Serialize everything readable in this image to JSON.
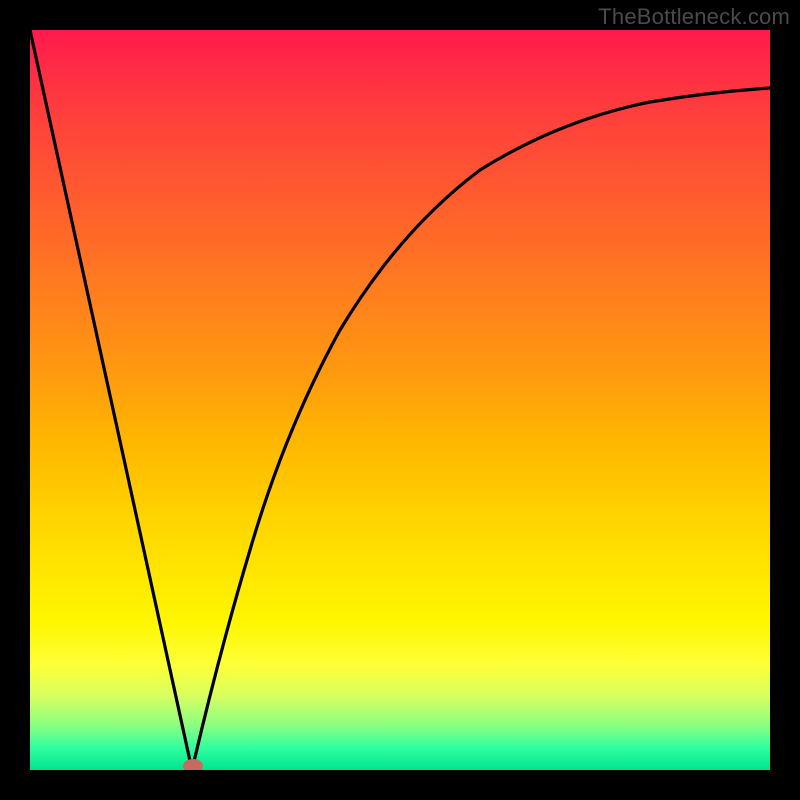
{
  "credit": "TheBottleneck.com",
  "chart_data": {
    "type": "line",
    "title": "",
    "xlabel": "",
    "ylabel": "",
    "xlim": [
      0,
      100
    ],
    "ylim": [
      0,
      100
    ],
    "grid": false,
    "legend": false,
    "series": [
      {
        "name": "left-branch",
        "x": [
          0,
          5,
          10,
          15,
          20,
          22
        ],
        "values": [
          100,
          77,
          54,
          31,
          8,
          0
        ]
      },
      {
        "name": "right-branch",
        "x": [
          22,
          25,
          28,
          32,
          36,
          40,
          45,
          50,
          55,
          60,
          65,
          70,
          75,
          80,
          85,
          90,
          95,
          100
        ],
        "values": [
          0,
          12,
          24,
          37,
          47,
          55,
          62,
          68,
          73,
          77,
          80,
          83,
          85,
          87,
          88.5,
          89.5,
          90.3,
          91
        ]
      }
    ],
    "marker": {
      "x": 22,
      "y": 0.5,
      "color": "#c86b5f"
    },
    "gradient_stops": [
      {
        "pct": 0,
        "color": "#ff1a4d"
      },
      {
        "pct": 56,
        "color": "#ffb800"
      },
      {
        "pct": 80,
        "color": "#fff600"
      },
      {
        "pct": 100,
        "color": "#00e38e"
      }
    ]
  }
}
